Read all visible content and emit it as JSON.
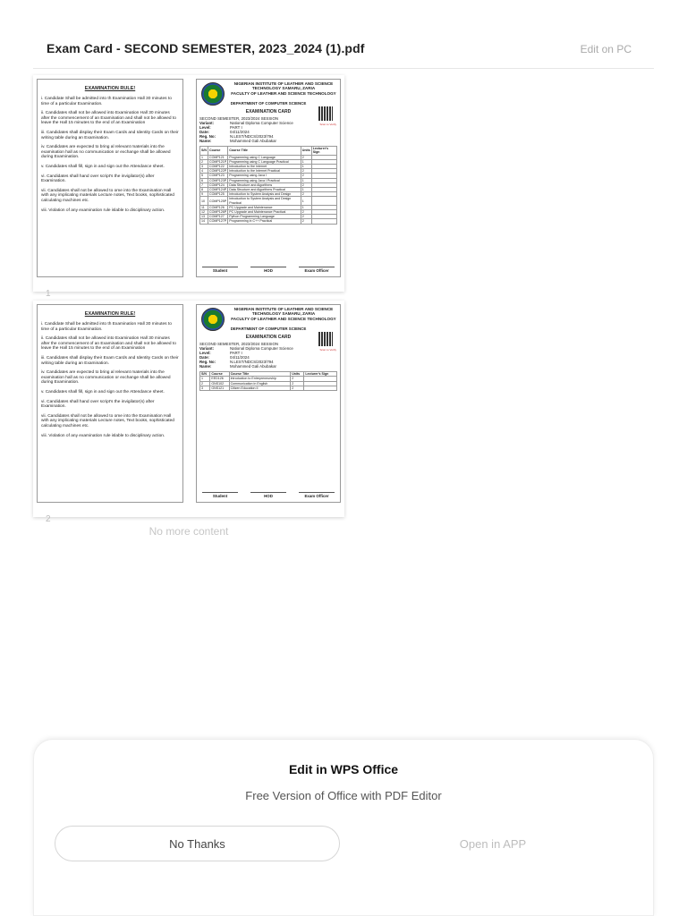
{
  "header": {
    "title": "Exam Card - SECOND SEMESTER, 2023_2024 (1).pdf",
    "edit_on_pc": "Edit on PC"
  },
  "rules": {
    "title": "EXAMINATION RULE!",
    "items": [
      "i.            Candidate Shall be admitted into th Examination Hall 30 minutes to time of a particular Examination.",
      "ii.            Candidates shall not be allowed into Examination Hall 30 minutes after the commencement of an Examination and shall not be allowed to leave the Hall 15 minutes to the end of an Examination",
      "iii.           Candidates shall display their Exam Cards and Identity Cards on their writing table during an Examination.",
      "iv.           Candidates are expected to bring al relevant materials into the examination hall as no communication or exchange shall be allowed during Examination.",
      "v.            Candidates shall fill, sign in and sign out the Attendance sheet.",
      "vi.           Candidates shall hand over script's the invigilator(s) after Examination.",
      "vii.          Candidates shall not be allowed to ome into the Examination Hall with any implicating materials Lecture notes, Text books, sophisticated calculating machines etc.",
      "viii.          Violation of any examination rule islable to disciplinary action."
    ]
  },
  "card": {
    "institution": "NIGERIAN INSTITUTE OF LEATHER AND SCIENCE TECHNOLOGY SAMARU, ZARIA",
    "faculty": "FACULTY OF LEATHER AND SCIENCE TECHNOLOGY",
    "department": "DEPARTMENT OF COMPUTER SCIENCE",
    "card_title": "EXAMINATION CARD",
    "session": "SECOND SEMESTER, 2023/2024 SESSION",
    "qr_caption": "Scan to Verify",
    "fields": [
      {
        "k": "Variant:",
        "v": "National Diploma Computer Science"
      },
      {
        "k": "Level:",
        "v": "PART I"
      },
      {
        "k": "Date:",
        "v": "04/11/2024"
      },
      {
        "k": "Reg. No:",
        "v": "N.LEST/NDCS/2023/794"
      },
      {
        "k": "Name:",
        "v": "Mohammed Gali Abubakar"
      }
    ],
    "table_headers": [
      "S/N",
      "Course",
      "Course Title",
      "Units",
      "Lecturer's Sign"
    ],
    "signatures": [
      "Student",
      "HOD",
      "Exam Officer"
    ]
  },
  "pages": [
    {
      "number": "1",
      "courses": [
        [
          "1",
          "COMP121",
          "Programming using C Language",
          "2"
        ],
        [
          "2",
          "COMP121P",
          "Programming using C Language Practical",
          "1"
        ],
        [
          "3",
          "COMP122",
          "Introduction to the Internet",
          "1"
        ],
        [
          "4",
          "COMP122P",
          "Introduction to the Internet Practical",
          "2"
        ],
        [
          "5",
          "COMP123",
          "Programming using Java I",
          "2"
        ],
        [
          "6",
          "COMP123P",
          "Programming using Java I Practical",
          "1"
        ],
        [
          "7",
          "COMP124",
          "Data Structure and Algorithms",
          "2"
        ],
        [
          "8",
          "COMP124P",
          "Data Structure and Algorithms Practical",
          "1"
        ],
        [
          "9",
          "COMP125",
          "Introduction to System Analysis and Design",
          "2"
        ],
        [
          "10",
          "COMP125P",
          "Introduction to System Analysis and Design Practical",
          "1"
        ],
        [
          "11",
          "COMP126",
          "PC Upgrade and Maintenance",
          "1"
        ],
        [
          "12",
          "COMP126P",
          "PC Upgrade and Maintenance Practical",
          "2"
        ],
        [
          "13",
          "COMP127",
          "Python Programming Language",
          "2"
        ],
        [
          "14",
          "COMP127P",
          "Programming in C++ Practical",
          "2"
        ]
      ]
    },
    {
      "number": "2",
      "courses": [
        [
          "1",
          "EED126",
          "Introduction to Entrepreneurship",
          "2"
        ],
        [
          "2",
          "GNS102",
          "Communication in English",
          "2"
        ],
        [
          "3",
          "GNS121",
          "Citizen Education II",
          "2"
        ]
      ]
    }
  ],
  "footer_note": "No more content",
  "sheet": {
    "title": "Edit in WPS Office",
    "subtitle": "Free Version of Office with PDF Editor",
    "no_thanks": "No Thanks",
    "open_in_app": "Open in APP"
  }
}
